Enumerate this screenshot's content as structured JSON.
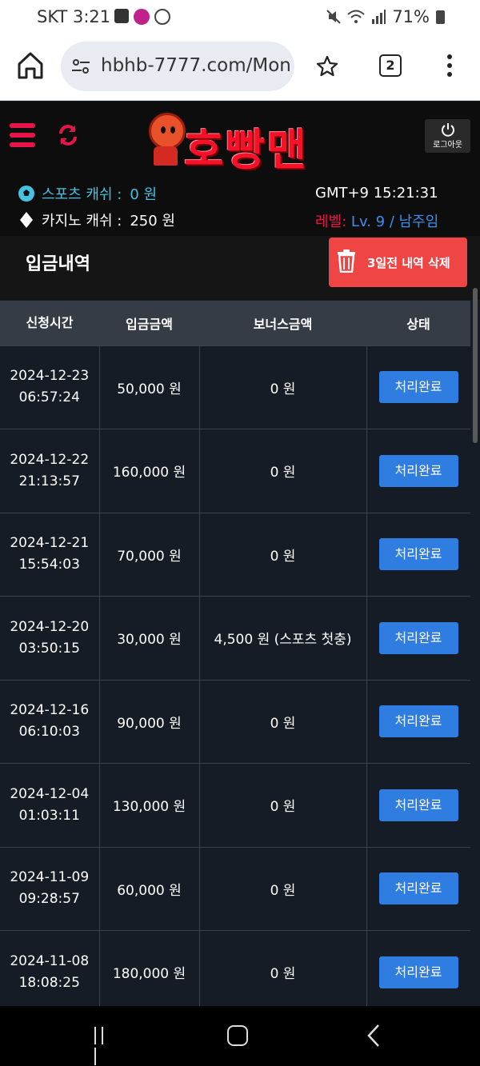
{
  "status_bar": {
    "carrier_time": "SKT 3:21",
    "battery": "71%"
  },
  "browser": {
    "url": "hbhb-7777.com/Mon",
    "tab_count": "2"
  },
  "site": {
    "logo_text": "호빵맨",
    "logout_label": "로그아웃",
    "sports_cash_label": "스포츠 캐쉬 :",
    "sports_cash_value": "0 원",
    "casino_cash_label": "카지노 캐쉬 :",
    "casino_cash_value": "250 원",
    "gmt": "GMT+9 15:21:31",
    "level_label": "레벨:",
    "level_value": "Lv. 9 / 남주임",
    "accent_color": "#e8154a"
  },
  "section": {
    "title": "입금내역",
    "delete_button": "3일전 내역 삭제"
  },
  "table": {
    "headers": [
      "신청시간",
      "입금금액",
      "보너스금액",
      "상태"
    ],
    "rows": [
      {
        "date": "2024-12-23",
        "time": "06:57:24",
        "amount": "50,000 원",
        "bonus": "0 원",
        "status": "처리완료"
      },
      {
        "date": "2024-12-22",
        "time": "21:13:57",
        "amount": "160,000 원",
        "bonus": "0 원",
        "status": "처리완료"
      },
      {
        "date": "2024-12-21",
        "time": "15:54:03",
        "amount": "70,000 원",
        "bonus": "0 원",
        "status": "처리완료"
      },
      {
        "date": "2024-12-20",
        "time": "03:50:15",
        "amount": "30,000 원",
        "bonus": "4,500 원 (스포츠 첫충)",
        "status": "처리완료"
      },
      {
        "date": "2024-12-16",
        "time": "06:10:03",
        "amount": "90,000 원",
        "bonus": "0 원",
        "status": "처리완료"
      },
      {
        "date": "2024-12-04",
        "time": "01:03:11",
        "amount": "130,000 원",
        "bonus": "0 원",
        "status": "처리완료"
      },
      {
        "date": "2024-11-09",
        "time": "09:28:57",
        "amount": "60,000 원",
        "bonus": "0 원",
        "status": "처리완료"
      },
      {
        "date": "2024-11-08",
        "time": "18:08:25",
        "amount": "180,000 원",
        "bonus": "0 원",
        "status": "처리완료"
      }
    ]
  }
}
